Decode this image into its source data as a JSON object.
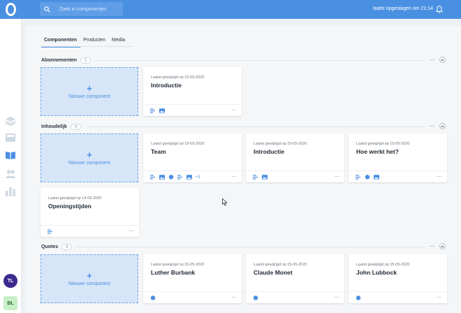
{
  "sidebar": {
    "logo_icon": "app-logo",
    "nav_items": [
      {
        "icon": "layers-icon",
        "active": false
      },
      {
        "icon": "component-icon",
        "active": false
      },
      {
        "icon": "book-icon",
        "active": true
      },
      {
        "icon": "users-icon",
        "active": false
      },
      {
        "icon": "bar-chart-icon",
        "active": false
      }
    ],
    "user_avatars": [
      {
        "initials": "TL",
        "color": "#3d2a8f"
      },
      {
        "initials": "BL",
        "color": "#c9efc9"
      }
    ]
  },
  "topbar": {
    "search_placeholder": "Zoek in componenten",
    "saved_status": "laatst opgeslagen om 21:14",
    "bell_icon": "bell-icon",
    "accent": "#4a90e2"
  },
  "tabs": [
    {
      "label": "Componenten",
      "active": true
    },
    {
      "label": "Producten",
      "active": false
    },
    {
      "label": "Media",
      "active": false
    }
  ],
  "sections": [
    {
      "title": "Abonnementen",
      "count": "1",
      "new_label": "Nieuwe component",
      "cards": [
        {
          "date": "Laatst gewijzigd op 15-05-2020",
          "title": "Introductie",
          "icons": [
            "text-icon",
            "image-icon"
          ],
          "extra": ""
        }
      ]
    },
    {
      "title": "Inhoudelijk",
      "count": "4",
      "new_label": "Nieuwe component",
      "cards": [
        {
          "date": "Laatst gewijzigd op 15-05-2020",
          "title": "Team",
          "icons": [
            "text-icon",
            "image-icon",
            "quote-icon",
            "text-icon",
            "image-icon"
          ],
          "extra": "+1"
        },
        {
          "date": "Laatst gewijzigd op 15-05-2020",
          "title": "Introductie",
          "icons": [
            "text-icon",
            "image-icon"
          ],
          "extra": ""
        },
        {
          "date": "Laatst gewijzigd op 15-05-2020",
          "title": "Hoe werkt het?",
          "icons": [
            "text-icon",
            "quote-icon",
            "image-icon"
          ],
          "extra": ""
        },
        {
          "date": "Laatst gewijzigd op 14-05-2020",
          "title": "Openingstijden",
          "icons": [
            "text-icon"
          ],
          "extra": ""
        }
      ]
    },
    {
      "title": "Quotes",
      "count": "4",
      "new_label": "Nieuwe component",
      "cards": [
        {
          "date": "Laatst gewijzigd op 15-05-2020",
          "title": "Luther Burbank",
          "icons": [
            "quote-icon"
          ],
          "extra": ""
        },
        {
          "date": "Laatst gewijzigd op 15-05-2020",
          "title": "Claude Monet",
          "icons": [
            "quote-icon"
          ],
          "extra": ""
        },
        {
          "date": "Laatst gewijzigd op 15-05-2020",
          "title": "John Lubbock",
          "icons": [
            "quote-icon"
          ],
          "extra": ""
        }
      ]
    }
  ],
  "more_glyph": "···",
  "plus_glyph": "+"
}
